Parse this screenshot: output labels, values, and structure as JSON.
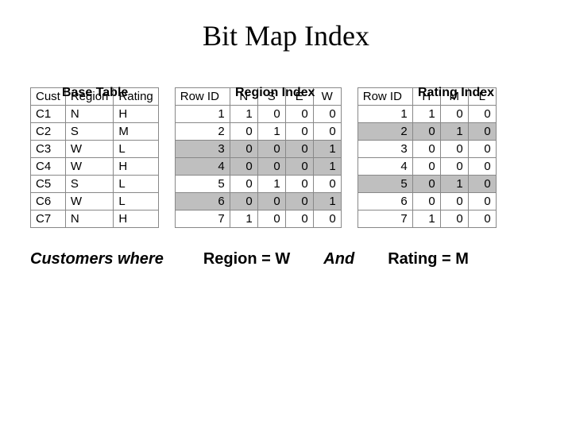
{
  "title": "Bit Map Index",
  "baseTable": {
    "label": "Base Table",
    "headers": [
      "Cust",
      "Region",
      "Rating"
    ],
    "rows": [
      [
        "C1",
        "N",
        "H"
      ],
      [
        "C2",
        "S",
        "M"
      ],
      [
        "C3",
        "W",
        "L"
      ],
      [
        "C4",
        "W",
        "H"
      ],
      [
        "C5",
        "S",
        "L"
      ],
      [
        "C6",
        "W",
        "L"
      ],
      [
        "C7",
        "N",
        "H"
      ]
    ]
  },
  "regionIndex": {
    "label": "Region Index",
    "headers": [
      "Row ID",
      "N",
      "S",
      "E",
      "W"
    ],
    "rows": [
      {
        "cells": [
          "1",
          "1",
          "0",
          "0",
          "0"
        ],
        "shaded": false
      },
      {
        "cells": [
          "2",
          "0",
          "1",
          "0",
          "0"
        ],
        "shaded": false
      },
      {
        "cells": [
          "3",
          "0",
          "0",
          "0",
          "1"
        ],
        "shaded": true
      },
      {
        "cells": [
          "4",
          "0",
          "0",
          "0",
          "1"
        ],
        "shaded": true
      },
      {
        "cells": [
          "5",
          "0",
          "1",
          "0",
          "0"
        ],
        "shaded": false
      },
      {
        "cells": [
          "6",
          "0",
          "0",
          "0",
          "1"
        ],
        "shaded": true
      },
      {
        "cells": [
          "7",
          "1",
          "0",
          "0",
          "0"
        ],
        "shaded": false
      }
    ]
  },
  "ratingIndex": {
    "label": "Rating Index",
    "headers": [
      "Row ID",
      "H",
      "M",
      "L"
    ],
    "rows": [
      {
        "cells": [
          "1",
          "1",
          "0",
          "0"
        ],
        "shaded": false
      },
      {
        "cells": [
          "2",
          "0",
          "1",
          "0"
        ],
        "shaded": true
      },
      {
        "cells": [
          "3",
          "0",
          "0",
          "0"
        ],
        "shaded": false
      },
      {
        "cells": [
          "4",
          "0",
          "0",
          "0"
        ],
        "shaded": false
      },
      {
        "cells": [
          "5",
          "0",
          "1",
          "0"
        ],
        "shaded": true
      },
      {
        "cells": [
          "6",
          "0",
          "0",
          "0"
        ],
        "shaded": false
      },
      {
        "cells": [
          "7",
          "1",
          "0",
          "0"
        ],
        "shaded": false
      }
    ]
  },
  "query": {
    "customersWhere": "Customers where",
    "regionCond": "Region = W",
    "and": "And",
    "ratingCond": "Rating = M"
  }
}
